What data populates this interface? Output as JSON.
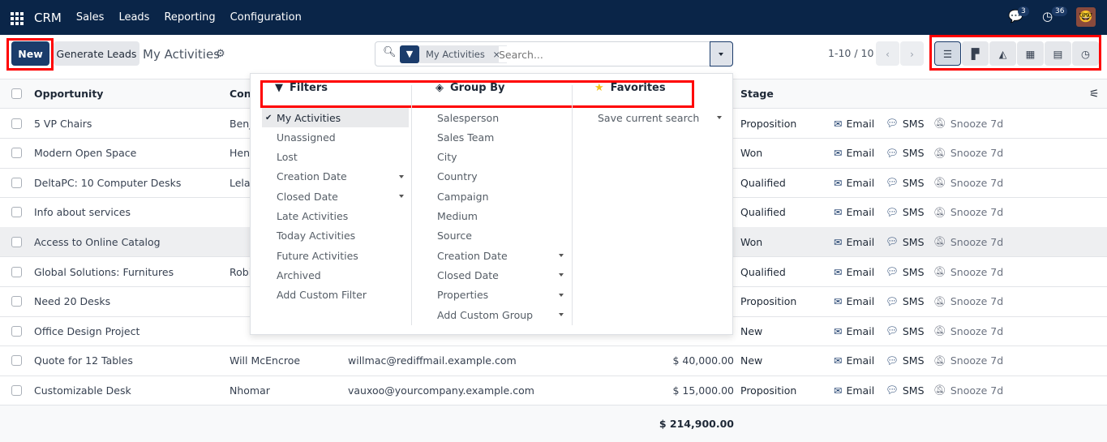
{
  "navbar": {
    "app": "CRM",
    "menu": [
      "Sales",
      "Leads",
      "Reporting",
      "Configuration"
    ],
    "messages_count": "3",
    "activities_count": "36"
  },
  "control": {
    "new": "New",
    "generate": "Generate Leads",
    "title": "My Activities",
    "facet": "My Activities",
    "search_placeholder": "Search...",
    "pager": "1-10 / 10",
    "views": [
      "list-icon",
      "kanban-icon",
      "graph-icon",
      "pivot-icon",
      "calendar-icon",
      "activity-icon"
    ]
  },
  "table": {
    "headers": {
      "opportunity": "Opportunity",
      "contact": "Cont",
      "stage": "Stage"
    },
    "rows": [
      {
        "name": "5 VP Chairs",
        "contact": "Benj",
        "email": "",
        "revenue": "",
        "stage": "Proposition"
      },
      {
        "name": "Modern Open Space",
        "contact": "Henr",
        "email": "",
        "revenue": "",
        "stage": "Won"
      },
      {
        "name": "DeltaPC: 10 Computer Desks",
        "contact": "Lelar",
        "email": "",
        "revenue": "",
        "stage": "Qualified"
      },
      {
        "name": "Info about services",
        "contact": "",
        "email": "",
        "revenue": "",
        "stage": "Qualified"
      },
      {
        "name": "Access to Online Catalog",
        "contact": "",
        "email": "",
        "revenue": "",
        "stage": "Won"
      },
      {
        "name": "Global Solutions: Furnitures",
        "contact": "Robi",
        "email": "",
        "revenue": "",
        "stage": "Qualified"
      },
      {
        "name": "Need 20 Desks",
        "contact": "",
        "email": "",
        "revenue": "",
        "stage": "Proposition"
      },
      {
        "name": "Office Design Project",
        "contact": "",
        "email": "",
        "revenue": "",
        "stage": "New"
      },
      {
        "name": "Quote for 12 Tables",
        "contact": "Will McEncroe",
        "email": "willmac@rediffmail.example.com",
        "revenue": "$ 40,000.00",
        "stage": "New"
      },
      {
        "name": "Customizable Desk",
        "contact": "Nhomar",
        "email": "vauxoo@yourcompany.example.com",
        "revenue": "$ 15,000.00",
        "stage": "Proposition"
      }
    ],
    "actions": {
      "email": "Email",
      "sms": "SMS",
      "snooze": "Snooze 7d"
    },
    "total": "$ 214,900.00"
  },
  "dropdown": {
    "filters": {
      "title": "Filters",
      "items": [
        "My Activities",
        "Unassigned",
        "Lost",
        "Creation Date",
        "Closed Date",
        "Late Activities",
        "Today Activities",
        "Future Activities",
        "Archived",
        "Add Custom Filter"
      ],
      "selected": "My Activities"
    },
    "groupby": {
      "title": "Group By",
      "items": [
        "Salesperson",
        "Sales Team",
        "City",
        "Country",
        "Campaign",
        "Medium",
        "Source",
        "Creation Date",
        "Closed Date",
        "Properties",
        "Add Custom Group"
      ]
    },
    "favorites": {
      "title": "Favorites",
      "items": [
        "Save current search"
      ]
    }
  },
  "colors": {
    "navbar": "#0a2548",
    "primary": "#1b3c6b",
    "highlight": "#f00"
  }
}
